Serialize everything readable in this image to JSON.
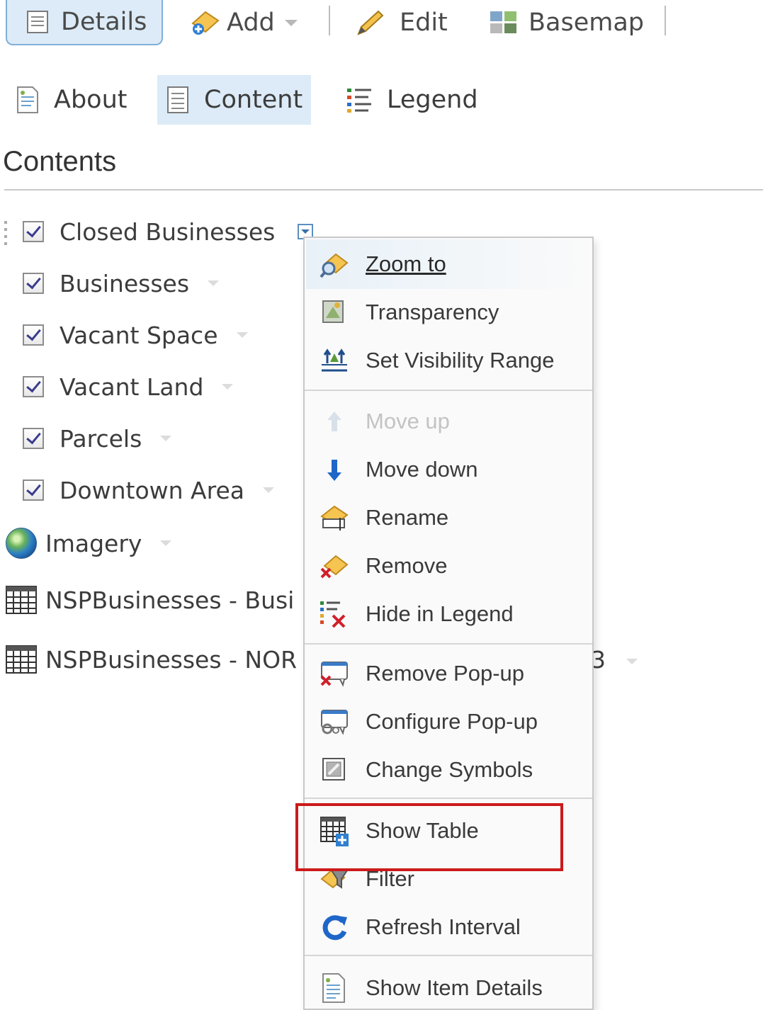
{
  "toolbar": {
    "details": "Details",
    "add": "Add",
    "edit": "Edit",
    "basemap": "Basemap"
  },
  "tabs": {
    "about": "About",
    "content": "Content",
    "legend": "Legend"
  },
  "contents_title": "Contents",
  "layers": [
    {
      "label": "Closed Businesses",
      "checked": true
    },
    {
      "label": "Businesses",
      "checked": true
    },
    {
      "label": "Vacant Space",
      "checked": true
    },
    {
      "label": "Vacant Land",
      "checked": true
    },
    {
      "label": "Parcels",
      "checked": true
    },
    {
      "label": "Downtown Area",
      "checked": true
    },
    {
      "label": "Imagery"
    },
    {
      "label": "NSPBusinesses - Busi"
    },
    {
      "label": "NSPBusinesses - NOR"
    }
  ],
  "layer_trailing_fragment": "3",
  "menu": {
    "items": [
      {
        "label": "Zoom to",
        "icon": "zoom-to-icon"
      },
      {
        "label": "Transparency",
        "icon": "transparency-icon"
      },
      {
        "label": "Set Visibility Range",
        "icon": "visibility-range-icon"
      },
      {
        "label": "Move up",
        "icon": "arrow-up-icon",
        "disabled": true
      },
      {
        "label": "Move down",
        "icon": "arrow-down-icon"
      },
      {
        "label": "Rename",
        "icon": "rename-icon"
      },
      {
        "label": "Remove",
        "icon": "remove-icon"
      },
      {
        "label": "Hide in Legend",
        "icon": "hide-legend-icon"
      },
      {
        "label": "Remove Pop-up",
        "icon": "remove-popup-icon"
      },
      {
        "label": "Configure Pop-up",
        "icon": "configure-popup-icon"
      },
      {
        "label": "Change Symbols",
        "icon": "change-symbols-icon"
      },
      {
        "label": "Show Table",
        "icon": "show-table-icon"
      },
      {
        "label": "Filter",
        "icon": "filter-icon"
      },
      {
        "label": "Refresh Interval",
        "icon": "refresh-icon"
      },
      {
        "label": "Show Item Details",
        "icon": "item-details-icon"
      }
    ]
  },
  "colors": {
    "selected_bg": "#dcebf7",
    "highlight": "#cc1a1a",
    "refresh": "#1f66c9"
  }
}
